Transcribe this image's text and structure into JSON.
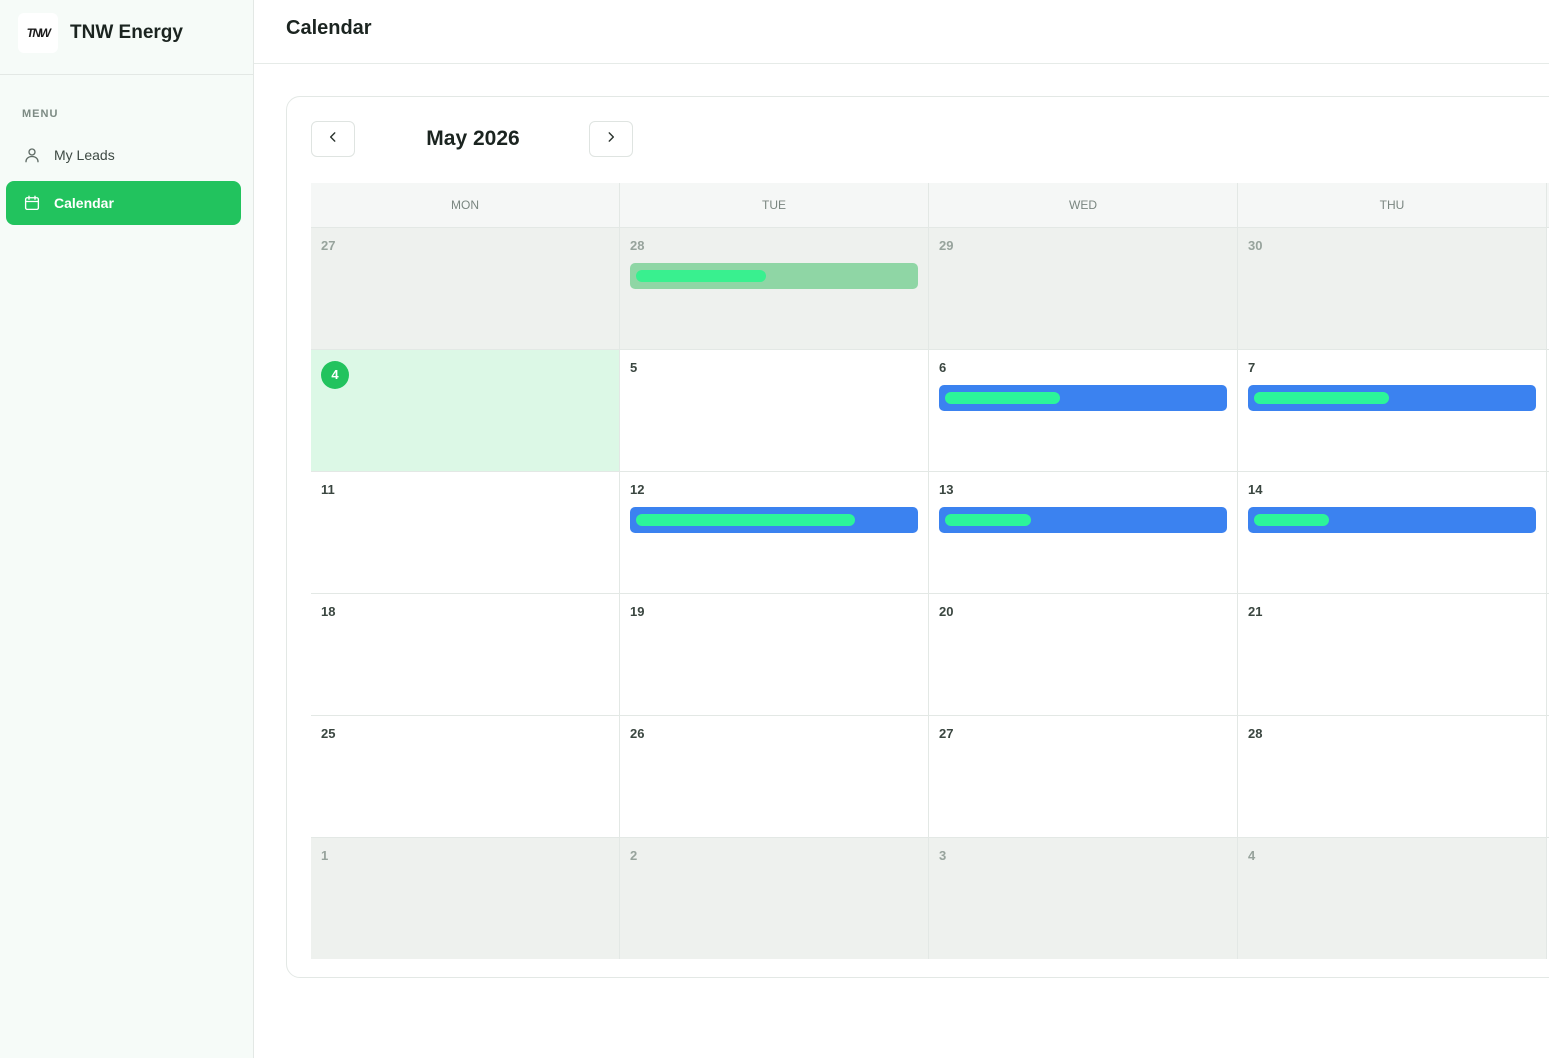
{
  "brand": {
    "logo_text": "TNW",
    "name": "TNW Energy"
  },
  "sidebar": {
    "menu_label": "MENU",
    "items": [
      {
        "label": "My Leads",
        "icon": "user-icon",
        "active": false
      },
      {
        "label": "Calendar",
        "icon": "calendar-icon",
        "active": true
      }
    ]
  },
  "header": {
    "title": "Calendar"
  },
  "calendar": {
    "month_label": "May 2026",
    "weekdays": [
      "MON",
      "TUE",
      "WED",
      "THU"
    ],
    "today": "4",
    "weeks": [
      [
        {
          "day": "27",
          "other": true,
          "events": []
        },
        {
          "day": "28",
          "other": true,
          "events": [
            {
              "style": "past",
              "mark": 0.45
            }
          ]
        },
        {
          "day": "29",
          "other": true,
          "events": []
        },
        {
          "day": "30",
          "other": true,
          "events": []
        }
      ],
      [
        {
          "day": "4",
          "today": true,
          "events": []
        },
        {
          "day": "5",
          "events": []
        },
        {
          "day": "6",
          "events": [
            {
              "style": "blue",
              "mark": 0.4
            }
          ]
        },
        {
          "day": "7",
          "events": [
            {
              "style": "blue",
              "mark": 0.47
            }
          ]
        }
      ],
      [
        {
          "day": "11",
          "events": []
        },
        {
          "day": "12",
          "events": [
            {
              "style": "blue",
              "mark": 0.76
            }
          ]
        },
        {
          "day": "13",
          "events": [
            {
              "style": "blue",
              "mark": 0.3
            }
          ]
        },
        {
          "day": "14",
          "events": [
            {
              "style": "blue",
              "mark": 0.26
            }
          ]
        }
      ],
      [
        {
          "day": "18",
          "events": []
        },
        {
          "day": "19",
          "events": []
        },
        {
          "day": "20",
          "events": []
        },
        {
          "day": "21",
          "events": []
        }
      ],
      [
        {
          "day": "25",
          "events": []
        },
        {
          "day": "26",
          "events": []
        },
        {
          "day": "27",
          "events": []
        },
        {
          "day": "28",
          "events": []
        }
      ],
      [
        {
          "day": "1",
          "other": true,
          "events": []
        },
        {
          "day": "2",
          "other": true,
          "events": []
        },
        {
          "day": "3",
          "other": true,
          "events": []
        },
        {
          "day": "4",
          "other": true,
          "events": []
        }
      ]
    ]
  },
  "colors": {
    "accent_green": "#22c35e",
    "today_bg": "#dcf8e6",
    "event_blue": "#3b82f0",
    "event_past": "#8fd6a5",
    "other_month_bg": "#eef1ee"
  }
}
